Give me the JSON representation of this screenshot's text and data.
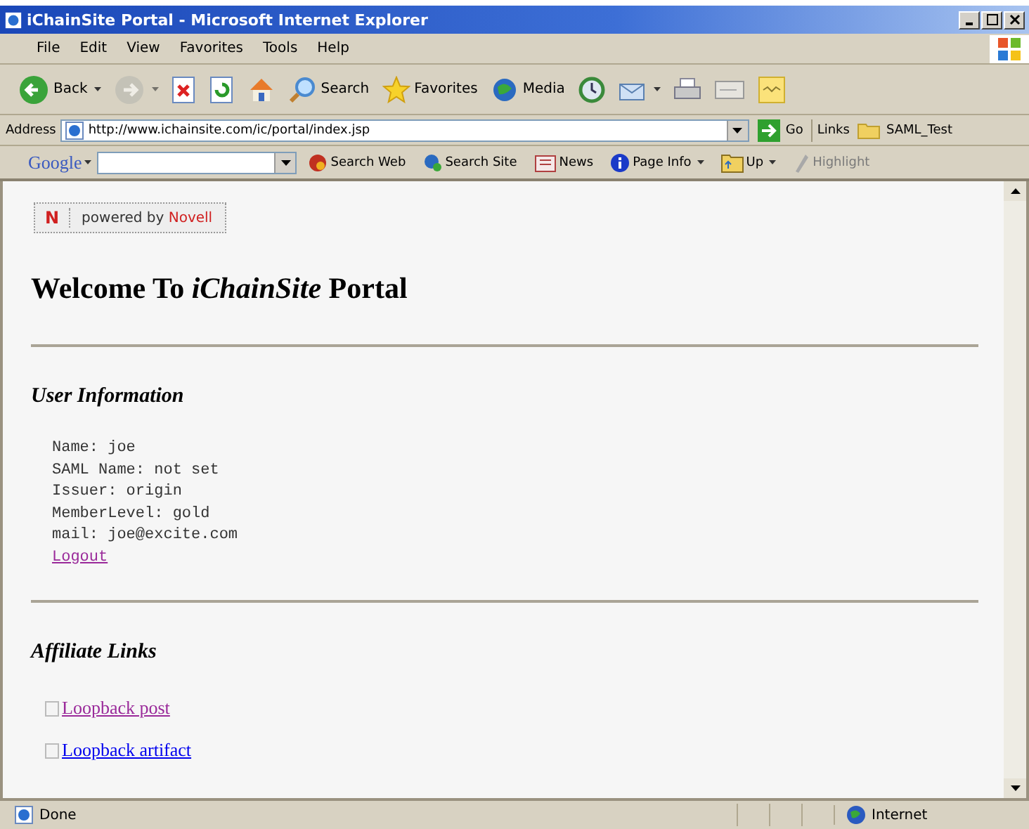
{
  "window": {
    "title": "iChainSite Portal - Microsoft Internet Explorer"
  },
  "menu": [
    "File",
    "Edit",
    "View",
    "Favorites",
    "Tools",
    "Help"
  ],
  "toolbar": [
    {
      "kind": "back",
      "label": "Back",
      "dropdown": true,
      "disabled": false
    },
    {
      "kind": "forward",
      "dropdown": true,
      "disabled": true
    },
    {
      "kind": "stop",
      "dropdown": false,
      "disabled": false
    },
    {
      "kind": "refresh",
      "dropdown": false,
      "disabled": false
    },
    {
      "kind": "home",
      "dropdown": false,
      "disabled": false
    },
    {
      "kind": "search",
      "label": "Search",
      "dropdown": false,
      "disabled": false
    },
    {
      "kind": "favorites",
      "label": "Favorites",
      "dropdown": false,
      "disabled": false
    },
    {
      "kind": "media",
      "label": "Media",
      "dropdown": false,
      "disabled": false
    },
    {
      "kind": "history",
      "dropdown": false,
      "disabled": false
    },
    {
      "kind": "mail",
      "dropdown": true,
      "disabled": false
    },
    {
      "kind": "print",
      "dropdown": false,
      "disabled": false
    },
    {
      "kind": "edit",
      "dropdown": false,
      "disabled": false
    },
    {
      "kind": "note",
      "dropdown": false,
      "disabled": false
    }
  ],
  "address_bar": {
    "label": "Address",
    "value": "http://www.ichainsite.com/ic/portal/index.jsp",
    "go": "Go",
    "links_label": "Links",
    "links": [
      "SAML_Test"
    ]
  },
  "google_bar": {
    "logo": "Google",
    "items": [
      {
        "kind": "web",
        "label": "Search Web",
        "dropdown": false,
        "disabled": false
      },
      {
        "kind": "site",
        "label": "Search Site",
        "dropdown": false,
        "disabled": false
      },
      {
        "kind": "news",
        "label": "News",
        "dropdown": false,
        "disabled": false
      },
      {
        "kind": "info",
        "label": "Page Info",
        "dropdown": true,
        "disabled": false
      },
      {
        "kind": "up",
        "label": "Up",
        "dropdown": true,
        "disabled": false
      },
      {
        "kind": "highlight",
        "label": "Highlight",
        "dropdown": false,
        "disabled": true
      }
    ]
  },
  "page": {
    "badge": {
      "logo": "N",
      "text": "powered by",
      "brand": "Novell"
    },
    "heading": "Welcome To *iChainSite* Portal",
    "user_section": {
      "title": "User Information",
      "lines": [
        "Name: joe",
        "SAML Name: not set",
        "Issuer: origin",
        "MemberLevel: gold",
        "mail: joe@excite.com"
      ],
      "logout": {
        "label": "Logout",
        "visited": true
      }
    },
    "affiliate_section": {
      "title": "Affiliate Links",
      "links": [
        {
          "label": "Loopback post",
          "visited": true
        },
        {
          "label": "Loopback artifact",
          "visited": false
        }
      ]
    }
  },
  "status_bar": {
    "text": "Done",
    "zone": "Internet"
  }
}
